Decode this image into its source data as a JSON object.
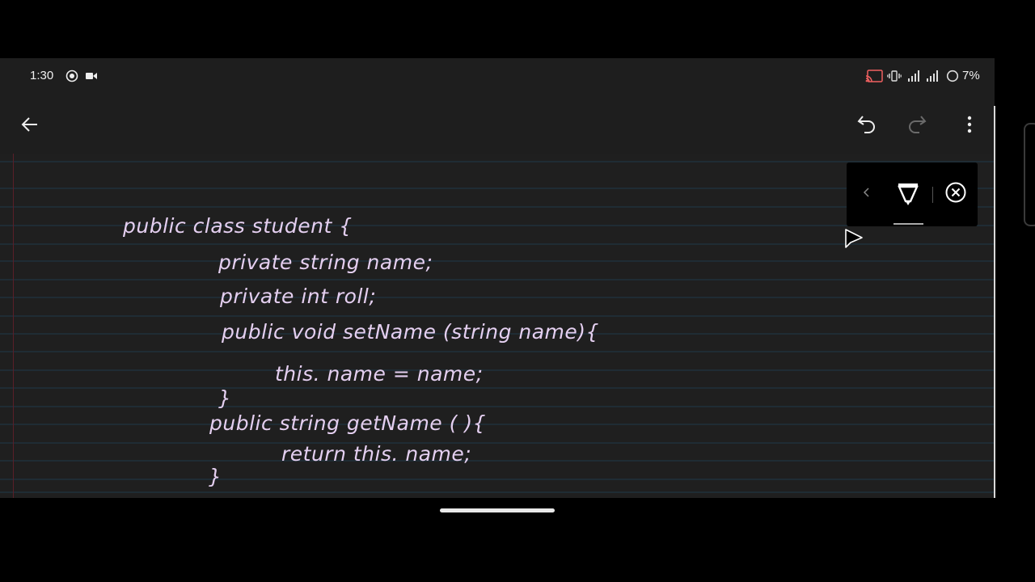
{
  "status_bar": {
    "time": "1:30",
    "left_icons": [
      "whatsapp-icon",
      "video-camera-icon"
    ],
    "right_icons": [
      "cast-icon",
      "vibrate-icon",
      "signal-icon",
      "signal-icon",
      "battery-saver-icon"
    ],
    "battery": "7%"
  },
  "app_bar": {
    "back": "arrow-left-icon",
    "undo": "undo-icon",
    "redo": "redo-icon",
    "more": "more-vertical-icon"
  },
  "pen_toolbar": {
    "collapse": "chevron-left-icon",
    "tool": "highlighter-icon",
    "close": "close-circle-icon"
  },
  "note": {
    "lines": [
      "public  class   student {",
      "private string name;",
      "private int roll;",
      "public void setName (string name){",
      "this. name = name;",
      "}",
      "public  string  getName ( ){",
      "return  this. name;",
      "}"
    ]
  },
  "colors": {
    "ink": "#e4cff0",
    "canvas": "#1f1f1f",
    "ruled_line": "#1f3a4a",
    "margin_line": "#5a1f28"
  }
}
